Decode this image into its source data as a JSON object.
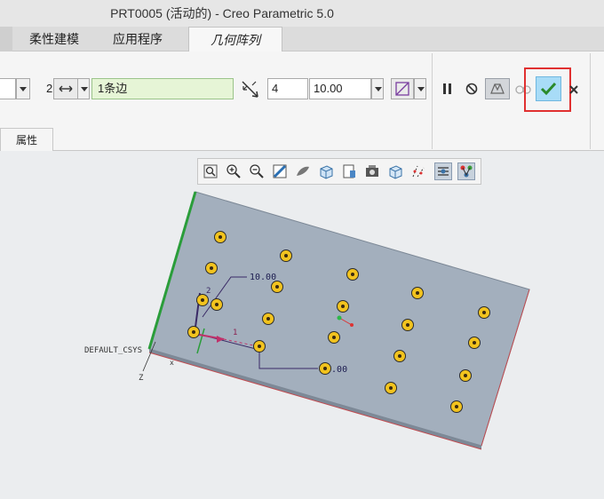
{
  "window": {
    "title": "PRT0005 (活动的) - Creo Parametric 5.0"
  },
  "tabs": [
    {
      "label": "柔性建模"
    },
    {
      "label": "应用程序"
    },
    {
      "label": "几何阵列"
    }
  ],
  "ribbon": {
    "pattern_count_label": "2",
    "reference_value": "1条边",
    "count_value": "4",
    "spacing_value": "10.00",
    "properties_tab": "属性"
  },
  "model": {
    "dimension_spacing": "10.00",
    "dimension_second": "20.00",
    "csys_label": "DEFAULT_CSYS",
    "axis_1": "1",
    "axis_2": "2",
    "axis_z": "Z"
  },
  "colors": {
    "accent_green": "#2a9d3a",
    "plate": "#a3afbd",
    "hole_yellow": "#f2c31e",
    "highlight_red": "#e03030",
    "ok_button_bg": "#a8dcf7"
  }
}
